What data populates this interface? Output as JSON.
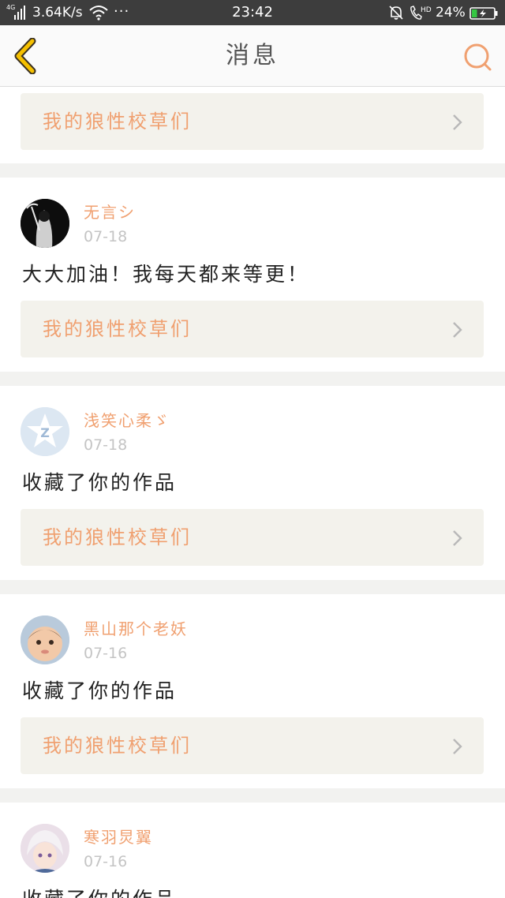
{
  "status_bar": {
    "network": "4G",
    "speed": "3.64K/s",
    "dots": "···",
    "time": "23:42",
    "battery_text": "24%",
    "battery_level": 0.24
  },
  "header": {
    "title": "消息"
  },
  "messages": [
    {
      "link_label": "我的狼性校草们"
    },
    {
      "user": "无言シ",
      "date": "07-18",
      "text": "大大加油！我每天都来等更！",
      "link_label": "我的狼性校草们"
    },
    {
      "user": "浅笑心柔ゞ",
      "date": "07-18",
      "text": "收藏了你的作品",
      "link_label": "我的狼性校草们"
    },
    {
      "user": "黑山那个老妖",
      "date": "07-16",
      "text": "收藏了你的作品",
      "link_label": "我的狼性校草们"
    },
    {
      "user": "寒羽炅翼",
      "date": "07-16",
      "text": "收藏了你的作品"
    }
  ],
  "colors": {
    "accent": "#f0a070",
    "status_bar": "#3d3d3d",
    "back_arrow": "#f5c000",
    "link_row_bg": "#f3f2ec"
  },
  "icons": {
    "back": "chevron-left-icon",
    "search": "search-icon",
    "row_arrow": "chevron-right-icon"
  }
}
